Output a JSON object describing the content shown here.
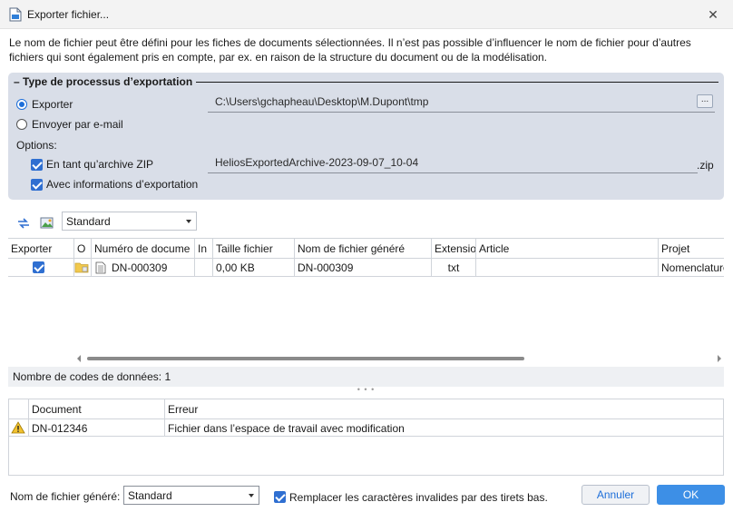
{
  "window": {
    "title": "Exporter fichier...",
    "close_glyph": "✕"
  },
  "info": "Le nom de fichier peut être défini pour les fiches de documents sélectionnées. Il n’est pas possible d’influencer le nom de fichier pour d’autres fichiers qui sont également pris en compte, par ex. en raison de la structure du document ou de la modélisation.",
  "export_group": {
    "title": "Type de processus d’exportation",
    "radio_export": "Exporter",
    "radio_email": "Envoyer par e-mail",
    "options_label": "Options:",
    "opt_zip": "En tant qu’archive ZIP",
    "opt_info": "Avec informations d’exportation",
    "path_value": "C:\\Users\\gchapheau\\Desktop\\M.Dupont\\tmp",
    "browse_label": "...",
    "zip_name": "HeliosExportedArchive-2023-09-07_10-04",
    "zip_ext": ".zip"
  },
  "toolbar": {
    "view_select": "Standard"
  },
  "grid": {
    "columns": [
      "Exporter",
      "O",
      "Numéro de docume",
      "In",
      "Taille fichier",
      "Nom de fichier généré",
      "Extensio",
      "Article",
      "Projet"
    ],
    "rows": [
      {
        "exporter": true,
        "doc_number": "DN-000309",
        "in": "",
        "size": "0,00 KB",
        "gen_name": "DN-000309",
        "ext": "txt",
        "article": "",
        "project": "Nomenclature"
      }
    ]
  },
  "status": {
    "count_text": "Nombre de codes de données: 1",
    "splitter_glyph": "• • •"
  },
  "errors": {
    "columns": [
      "Document",
      "Erreur"
    ],
    "rows": [
      {
        "document": "DN-012346",
        "error": "Fichier dans l’espace de travail avec modification"
      }
    ]
  },
  "footer": {
    "gen_name_label": "Nom de fichier généré:",
    "gen_name_select": "Standard",
    "replace_label": "Remplacer les caractères invalides par des tirets bas.",
    "cancel": "Annuler",
    "ok": "OK"
  },
  "colors": {
    "accent": "#1e6fd9",
    "group_bg": "#d9dee8",
    "ok_bg": "#3d8fe6"
  }
}
